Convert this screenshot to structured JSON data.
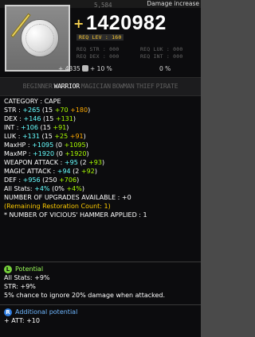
{
  "top": {
    "damage_increase_label": "Damage increase",
    "faint_number": "5,584"
  },
  "item": {
    "icon": "wrecking-ball-cape-icon",
    "power_star": "+",
    "power_value": "1420982"
  },
  "requirements": {
    "lev": "REQ LEV : 160",
    "str": "REQ STR : 000",
    "dex": "REQ DEX : 000",
    "luk": "REQ LUK : 000",
    "int": "REQ INT : 000"
  },
  "inline_stats": {
    "first": "+ 4335",
    "second": "+ 10 %",
    "third": "0 %"
  },
  "jobs": [
    {
      "label": "BEGINNER",
      "active": false
    },
    {
      "label": "WARRIOR",
      "active": true
    },
    {
      "label": "MAGICIAN",
      "active": false
    },
    {
      "label": "BOWMAN",
      "active": false
    },
    {
      "label": "THIEF",
      "active": false
    },
    {
      "label": "PIRATE",
      "active": false
    }
  ],
  "details": {
    "category": "CATEGORY : CAPE",
    "str": {
      "label": "STR : ",
      "total": "+265",
      "open": " (15 ",
      "a": "+70",
      "b": " +180",
      "close": ")"
    },
    "dex": {
      "label": "DEX : ",
      "total": "+146",
      "open": " (15 ",
      "a": "+131",
      "close": ")"
    },
    "int": {
      "label": "INT : ",
      "total": "+106",
      "open": " (15 ",
      "a": "+91",
      "close": ")"
    },
    "luk": {
      "label": "LUK : ",
      "total": "+131",
      "open": " (15 ",
      "a": "+25",
      "b": " +91",
      "close": ")"
    },
    "maxhp": {
      "label": "MaxHP : ",
      "total": "+1095",
      "open": " (0 ",
      "a": "+1095",
      "close": ")"
    },
    "maxmp": {
      "label": "MaxMP : ",
      "total": "+1920",
      "open": " (0 ",
      "a": "+1920",
      "close": ")"
    },
    "watt": {
      "label": "WEAPON ATTACK : ",
      "total": "+95",
      "open": " (2 ",
      "a": "+93",
      "close": ")"
    },
    "matt": {
      "label": "MAGIC ATTACK : ",
      "total": "+94",
      "open": " (2 ",
      "a": "+92",
      "close": ")"
    },
    "def": {
      "label": "DEF : ",
      "total": "+956",
      "open": " (250 ",
      "a": "+706",
      "close": ")"
    },
    "allstats": {
      "label": "All Stats: ",
      "total": "+4%",
      "open": " (0% ",
      "a": "+4%",
      "close": ")"
    },
    "upgrades": "NUMBER OF UPGRADES AVAILABLE : +0",
    "restoration": "(Remaining Restoration Count: 1)",
    "hammer": "* NUMBER OF VICIOUS' HAMMER APPLIED : 1"
  },
  "potential": {
    "badge": "L",
    "title": "Potential",
    "lines": [
      "All Stats: +9%",
      "STR: +9%",
      "5% chance to ignore 20% damage when attacked."
    ]
  },
  "additional_potential": {
    "badge": "R",
    "title": "Additional potential",
    "lines": [
      "+ ATT: +10"
    ]
  }
}
